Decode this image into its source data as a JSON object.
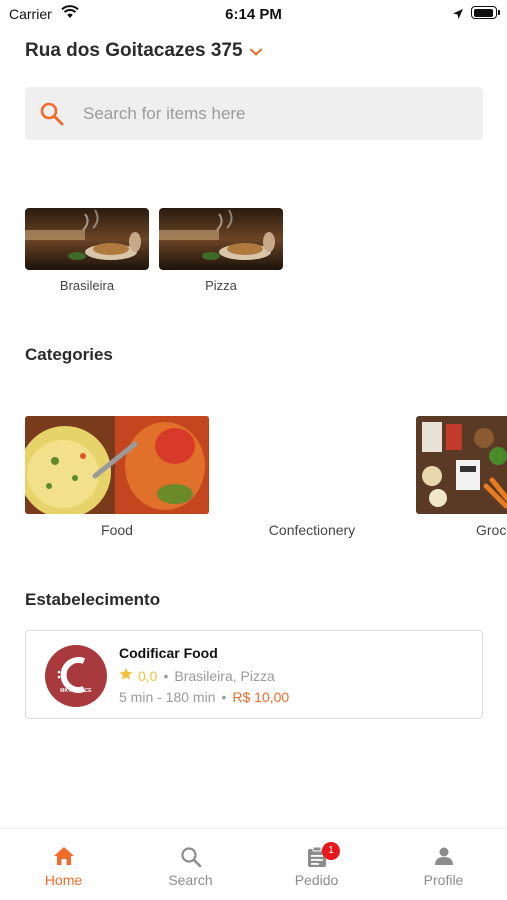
{
  "status_bar": {
    "carrier": "Carrier",
    "time": "6:14 PM",
    "wifi_icon": "wifi-icon",
    "location_icon": "location-arrow-icon",
    "battery_icon": "battery-icon"
  },
  "header": {
    "address": "Rua dos Goitacazes 375",
    "dropdown_icon": "chevron-down-icon"
  },
  "search": {
    "placeholder": "Search for items here",
    "value": "",
    "icon": "search-icon"
  },
  "cuisines": [
    {
      "label": "Brasileira"
    },
    {
      "label": "Pizza"
    }
  ],
  "categories_section": {
    "title": "Categories",
    "items": [
      {
        "label": "Food"
      },
      {
        "label": "Confectionery"
      },
      {
        "label": "Groc"
      }
    ]
  },
  "stores_section": {
    "title": "Estabelecimento",
    "stores": [
      {
        "name": "Codificar Food",
        "logo_text": "MKT PLACE",
        "rating": "0,0",
        "tags": "Brasileira, Pizza",
        "delivery_time": "5 min - 180 min",
        "delivery_fee": "R$ 10,00",
        "separator": "•"
      }
    ]
  },
  "tabbar": {
    "tabs": [
      {
        "label": "Home",
        "icon": "home-icon",
        "active": true
      },
      {
        "label": "Search",
        "icon": "search-icon",
        "active": false
      },
      {
        "label": "Pedido",
        "icon": "orders-icon",
        "active": false,
        "badge": "1"
      },
      {
        "label": "Profile",
        "icon": "profile-icon",
        "active": false
      }
    ]
  },
  "colors": {
    "accent": "#f26b2b",
    "rating_star": "#f5c13a",
    "badge": "#e8161d",
    "store_logo_bg": "#a83a3d"
  }
}
